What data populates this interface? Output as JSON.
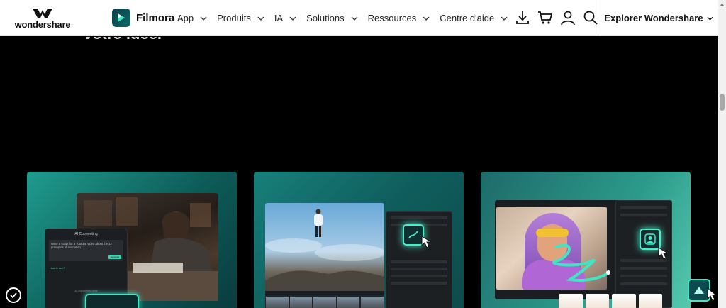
{
  "brand": {
    "name": "wondershare"
  },
  "product": {
    "name": "Filmora"
  },
  "nav": {
    "items": [
      {
        "label": "App"
      },
      {
        "label": "Produits"
      },
      {
        "label": "IA"
      },
      {
        "label": "Solutions"
      },
      {
        "label": "Ressources"
      },
      {
        "label": "Centre d'aide"
      }
    ],
    "explore_label": "Explorer Wondershare"
  },
  "hero": {
    "heading_fragment": "votre idée."
  },
  "cards": {
    "copywriting": {
      "panel_title": "AI Copywriting",
      "prompt_text": "Write a script for a Youtube video about the 12 principles of animation |",
      "generate_label": "Generate",
      "tip_label": "How to use?",
      "status_label": "AI Copywriting done"
    }
  },
  "colors": {
    "accent": "#3ee6c4",
    "card_dark": "#0a3c3d",
    "nav_bg": "#ffffff",
    "page_bg": "#000000"
  },
  "icons": [
    "download-icon",
    "cart-icon",
    "user-icon",
    "search-icon",
    "chevron-down-icon",
    "arrow-up-icon",
    "cookie-check-icon"
  ]
}
